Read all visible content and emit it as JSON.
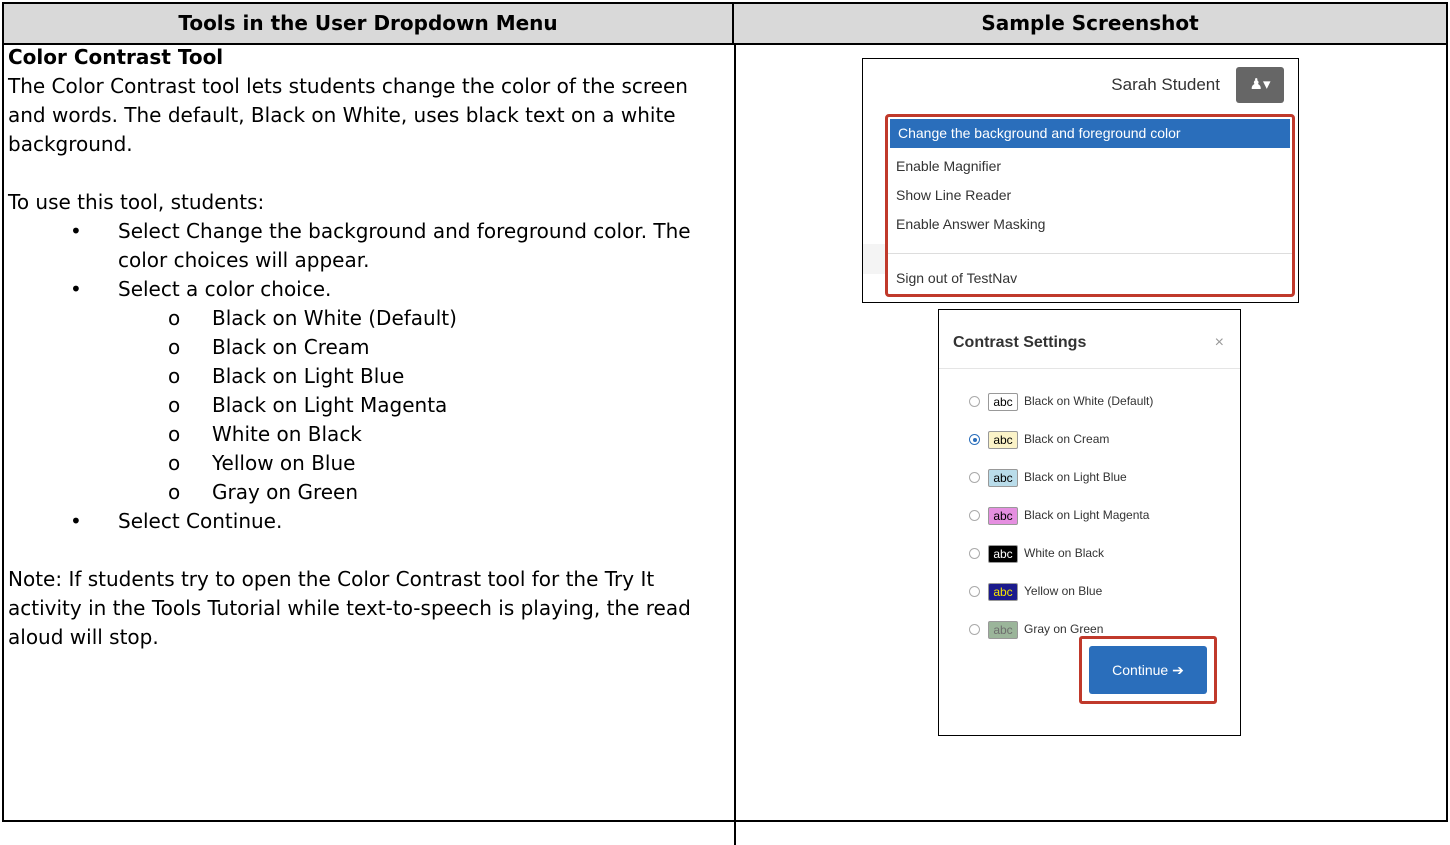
{
  "table": {
    "header_left": "Tools in the User Dropdown Menu",
    "header_right": "Sample Screenshot"
  },
  "tool": {
    "title": "Color Contrast Tool",
    "intro": "The Color Contrast tool lets students change the color of the screen and words. The default, Black on White, uses black text on a white background.",
    "use_heading": "To use this tool, students:",
    "steps": [
      "Select Change the background and foreground color. The color choices will appear.",
      "Select a color choice.",
      "Select Continue."
    ],
    "sub_marker": "o",
    "color_choices": [
      "Black on White (Default)",
      "Black on Cream",
      "Black on Light Blue",
      "Black on Light Magenta",
      "White on Black",
      "Yellow on Blue",
      "Gray on Green"
    ],
    "note": "Note: If students try to open the Color Contrast tool for the Try It activity in the Tools Tutorial while text-to-speech is playing, the read aloud will stop."
  },
  "screenshot_menu": {
    "username": "Sarah Student",
    "user_icon": "user-icon",
    "user_button_glyph": "♟▾",
    "items": [
      "Change the background and foreground color",
      "Enable Magnifier",
      "Show Line Reader",
      "Enable Answer Masking",
      "Sign out of TestNav"
    ],
    "active_color": "#2a6ebb",
    "highlight_color": "#c0392b"
  },
  "screenshot_dialog": {
    "title": "Contrast Settings",
    "close_glyph": "×",
    "swatch_text": "abc",
    "selected_index": 1,
    "options": [
      {
        "label": "Black on White (Default)",
        "bg": "#ffffff",
        "fg": "#000000"
      },
      {
        "label": "Black on Cream",
        "bg": "#fbf3c8",
        "fg": "#000000"
      },
      {
        "label": "Black on Light Blue",
        "bg": "#b9dcea",
        "fg": "#000000"
      },
      {
        "label": "Black on Light Magenta",
        "bg": "#e58fe0",
        "fg": "#000000"
      },
      {
        "label": "White on Black",
        "bg": "#000000",
        "fg": "#ffffff"
      },
      {
        "label": "Yellow on Blue",
        "bg": "#1b1a8c",
        "fg": "#f5e400"
      },
      {
        "label": "Gray on Green",
        "bg": "#9bb59a",
        "fg": "#6e6e6e"
      }
    ],
    "continue_label": "Continue ➔"
  }
}
